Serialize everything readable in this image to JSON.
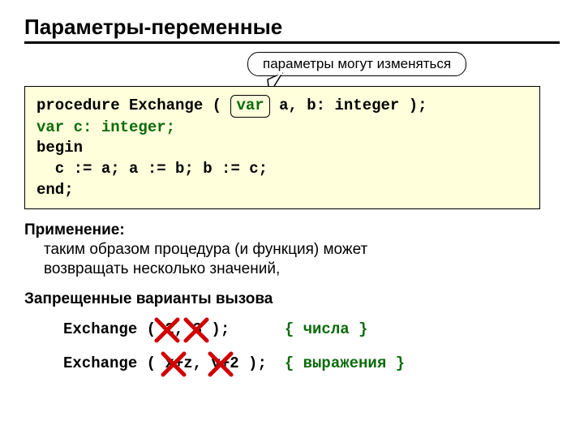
{
  "title": "Параметры-переменные",
  "callout": "параметры могут изменяться",
  "code": {
    "line1a": "procedure Exchange ( ",
    "line1_var": "var",
    "line1b": " a, b: integer );",
    "line2": "var c: integer;",
    "line3": "begin",
    "line4": "  c := a; a := b; b := c;",
    "line5": "end;"
  },
  "usage": {
    "heading": "Применение:",
    "text1": "таким образом процедура (и функция) может",
    "text2": "возвращать несколько значений,"
  },
  "forbidden": {
    "heading": "Запрещенные варианты вызова",
    "ex1_code": "Exchange ( 2, 3 );",
    "ex1_comment": "{ числа }",
    "ex2_code": "Exchange ( x+z, y+2 );",
    "ex2_comment": "{ выражения }"
  }
}
